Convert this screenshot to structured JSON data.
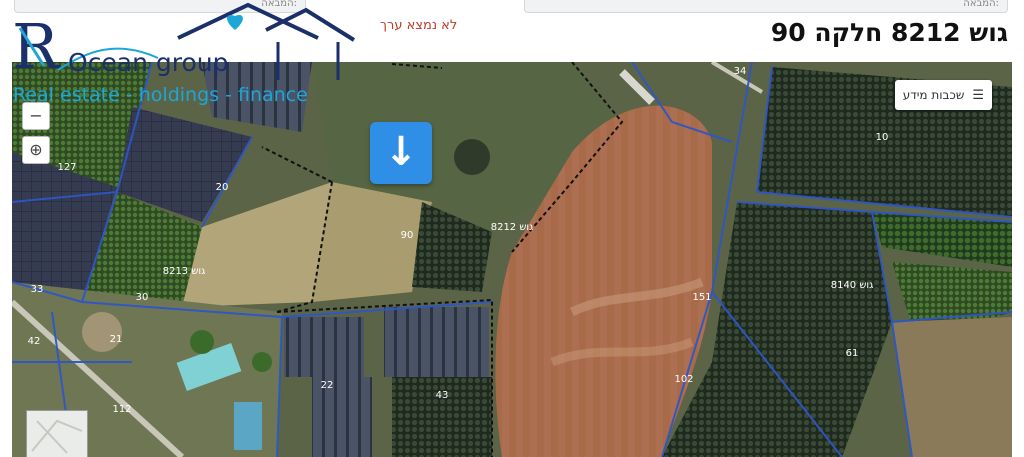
{
  "topbar": {
    "left_field": "המבאה:",
    "right_field": "המבאה:",
    "not_found": "לא נמצא ערך",
    "title": "גוש 8212 חלקה 90"
  },
  "logo": {
    "brand": "Ocean group",
    "tagline": "Real estate - holdings - finance"
  },
  "map": {
    "layers_label": "שכבות מידע",
    "zoom_out": "−",
    "zoom_magnify": "⊕",
    "locate_icon": "down-arrow-icon",
    "parcel_labels": {
      "block_8212": "גוש 8212",
      "parcel_90": "90",
      "block_8213": "גוש 8213",
      "block_8140": "גוש 8140",
      "p_10": "10",
      "p_20": "20",
      "p_127": "127",
      "p_61": "61",
      "p_33": "33",
      "p_43": "43",
      "p_22": "22",
      "p_21": "21",
      "p_30": "30",
      "p_151": "151",
      "p_112": "112",
      "p_102": "102",
      "p_42": "42",
      "p_34": "34"
    }
  },
  "colors": {
    "parcel_line": "#2e56c8",
    "highlight_line": "#111111",
    "title_text": "#111111",
    "not_found_text": "#c0392b",
    "brand_navy": "#1b2f6b",
    "brand_cyan": "#1da6d8",
    "locate_button": "#2f8ee6"
  }
}
